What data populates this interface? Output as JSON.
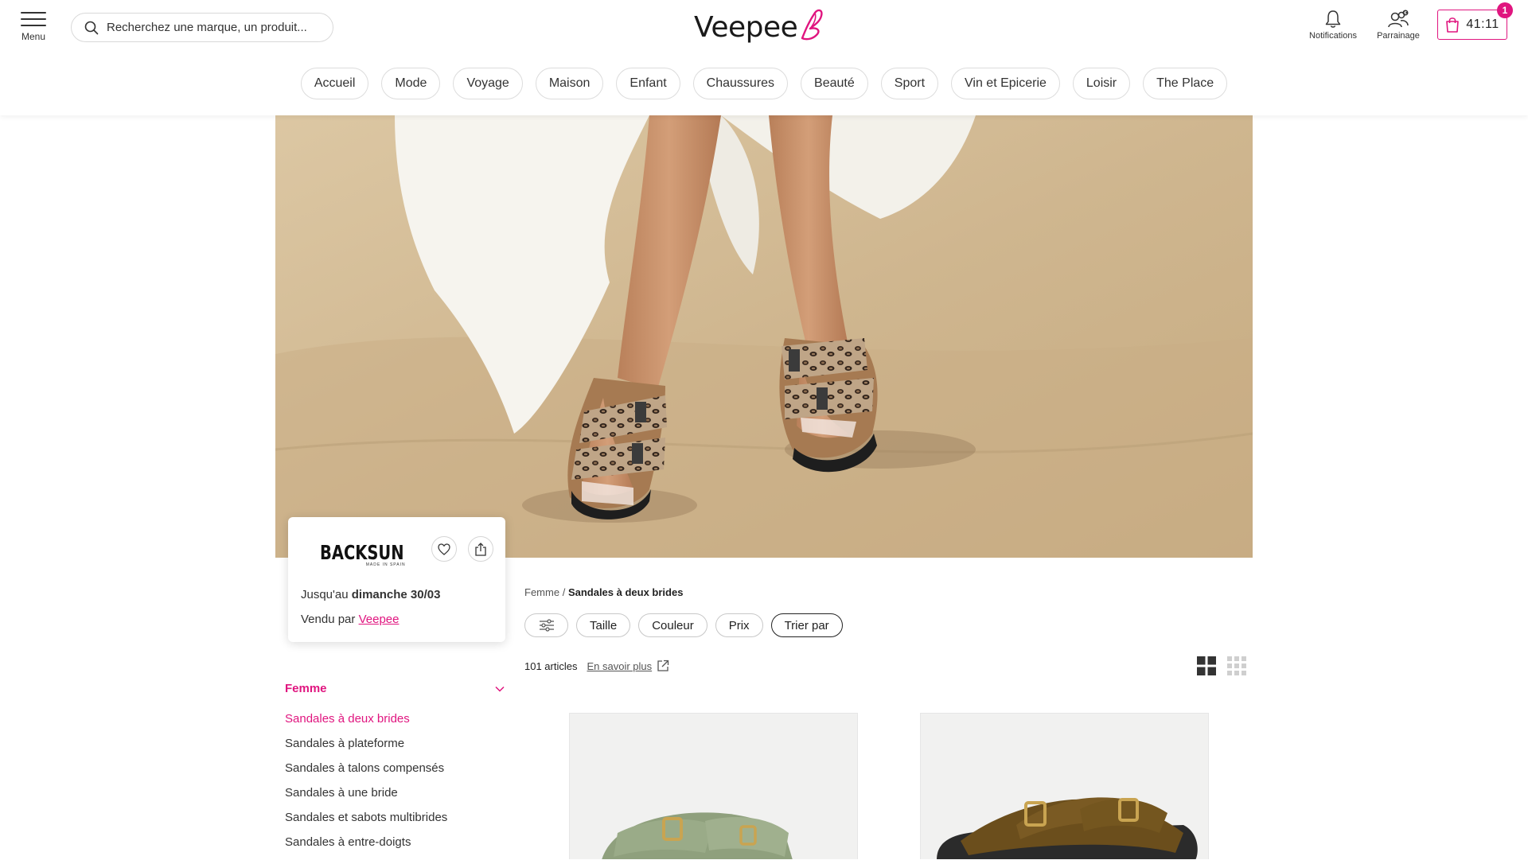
{
  "header": {
    "menu_label": "Menu",
    "search_placeholder": "Recherchez une marque, un produit...",
    "logo_text": "Veepee",
    "notifications_label": "Notifications",
    "referral_label": "Parrainage",
    "cart_timer": "41:11",
    "cart_count": "1",
    "accent_color": "#e0157f"
  },
  "nav": [
    "Accueil",
    "Mode",
    "Voyage",
    "Maison",
    "Enfant",
    "Chaussures",
    "Beauté",
    "Sport",
    "Vin et Epicerie",
    "Loisir",
    "The Place"
  ],
  "brand": {
    "name": "BACKSUN",
    "tagline": "MADE IN SPAIN",
    "date_prefix": "Jusqu'au",
    "date": "dimanche 30/03",
    "seller_prefix": "Vendu par",
    "seller": "Veepee"
  },
  "sidebar": {
    "category": "Femme",
    "items": [
      "Sandales à deux brides",
      "Sandales à plateforme",
      "Sandales à talons compensés",
      "Sandales à une bride",
      "Sandales et sabots multibrides",
      "Sandales à entre-doigts"
    ],
    "active_index": 0
  },
  "breadcrumb": {
    "parent": "Femme",
    "separator": "/",
    "current": "Sandales à deux brides"
  },
  "filters": [
    "Taille",
    "Couleur",
    "Prix",
    "Trier par"
  ],
  "results": {
    "count": "101 articles",
    "learn_more": "En savoir plus"
  },
  "products": [
    {
      "color": "sage-green suede"
    },
    {
      "color": "brown suede"
    }
  ]
}
